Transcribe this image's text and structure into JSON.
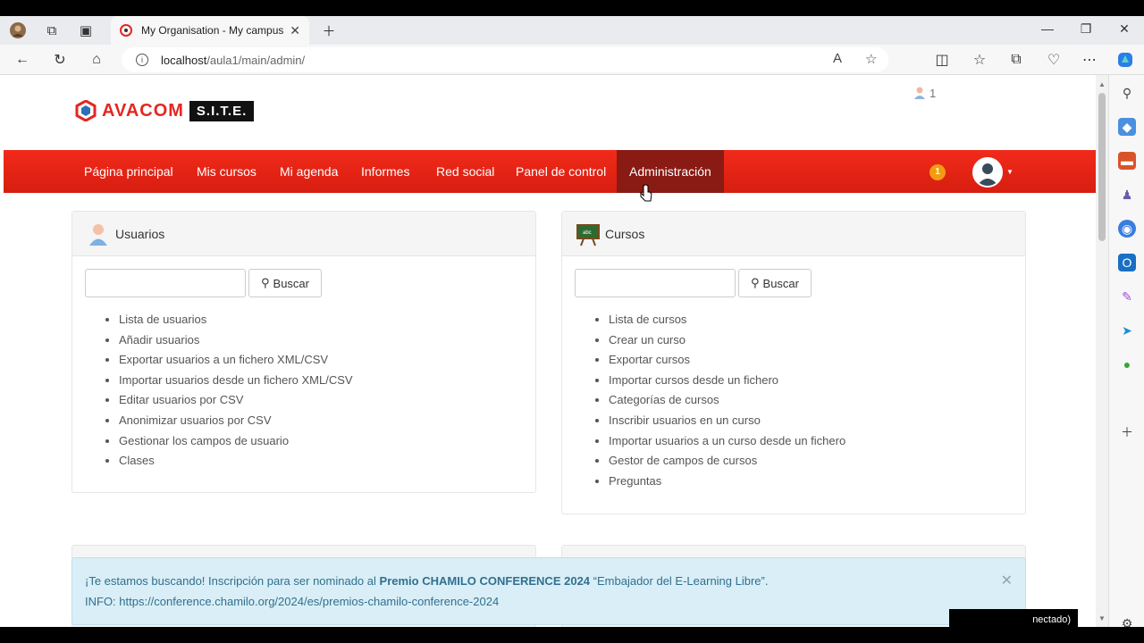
{
  "browser": {
    "tab_title": "My Organisation - My campus",
    "url_host": "localhost",
    "url_path": "/aula1/main/admin/"
  },
  "header": {
    "logo_text": "AVACOM",
    "logo_badge": "S.I.T.E.",
    "online_users": "1"
  },
  "navbar": {
    "items": [
      "Página principal",
      "Mis cursos",
      "Mi agenda",
      "Informes",
      "Red social",
      "Panel de control",
      "Administración"
    ],
    "notifications": "1"
  },
  "users_panel": {
    "title": "Usuarios",
    "search_button": "Buscar",
    "links": [
      "Lista de usuarios",
      "Añadir usuarios",
      "Exportar usuarios a un fichero XML/CSV",
      "Importar usuarios desde un fichero XML/CSV",
      "Editar usuarios por CSV",
      "Anonimizar usuarios por CSV",
      "Gestionar los campos de usuario",
      "Clases"
    ]
  },
  "courses_panel": {
    "title": "Cursos",
    "search_button": "Buscar",
    "links": [
      "Lista de cursos",
      "Crear un curso",
      "Exportar cursos",
      "Importar cursos desde un fichero",
      "Categorías de cursos",
      "Inscribir usuarios en un curso",
      "Importar usuarios a un curso desde un fichero",
      "Gestor de campos de cursos",
      "Preguntas"
    ]
  },
  "alert": {
    "prefix": "¡Te estamos buscando! Inscripción para ser nominado al",
    "bold": "Premio CHAMILO CONFERENCE 2024",
    "suffix": "“Embajador del E-Learning Libre”.",
    "info": "INFO: https://conference.chamilo.org/2024/es/premios-chamilo-conference-2024"
  },
  "chat": {
    "status": "nectado)"
  },
  "colors": {
    "navbar": "#e8251a",
    "navbar_active": "#8a1a14",
    "alert_bg": "#d9eef6",
    "badge": "#f39c12"
  }
}
